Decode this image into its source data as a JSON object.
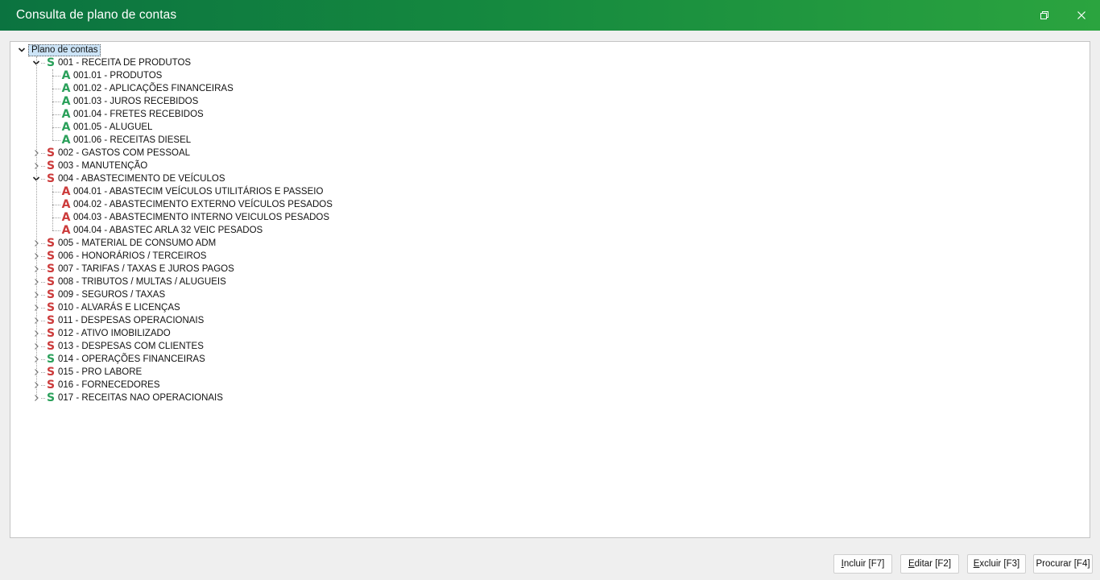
{
  "window": {
    "title": "Consulta de plano de contas"
  },
  "colors": {
    "title_bar_start": "#0b7340",
    "title_bar_end": "#2ba43f",
    "synthetic_green": "#2aa05a",
    "synthetic_red": "#cc3b3b",
    "analytic_green": "#2aa05a",
    "analytic_red": "#cc3b3b",
    "selection": "#cce4f7"
  },
  "tree": {
    "root": {
      "label": "Plano de contas",
      "expanded": true
    },
    "groups": [
      {
        "badge": "S",
        "color": "green",
        "label": "001 - RECEITA DE PRODUTOS",
        "expanded": true,
        "children": [
          {
            "badge": "A",
            "color": "green",
            "label": "001.01 - PRODUTOS"
          },
          {
            "badge": "A",
            "color": "green",
            "label": "001.02 - APLICAÇÕES FINANCEIRAS"
          },
          {
            "badge": "A",
            "color": "green",
            "label": "001.03 - JUROS RECEBIDOS"
          },
          {
            "badge": "A",
            "color": "green",
            "label": "001.04 - FRETES RECEBIDOS"
          },
          {
            "badge": "A",
            "color": "green",
            "label": "001.05 - ALUGUEL"
          },
          {
            "badge": "A",
            "color": "green",
            "label": "001.06 - RECEITAS DIESEL"
          }
        ]
      },
      {
        "badge": "S",
        "color": "red",
        "label": "002 - GASTOS COM PESSOAL",
        "expanded": false,
        "children": []
      },
      {
        "badge": "S",
        "color": "red",
        "label": "003 - MANUTENÇÃO",
        "expanded": false,
        "children": []
      },
      {
        "badge": "S",
        "color": "red",
        "label": "004 - ABASTECIMENTO DE VEÍCULOS",
        "expanded": true,
        "children": [
          {
            "badge": "A",
            "color": "red",
            "label": "004.01 - ABASTECIM VEÍCULOS UTILITÁRIOS E PASSEIO"
          },
          {
            "badge": "A",
            "color": "red",
            "label": "004.02 - ABASTECIMENTO EXTERNO VEÍCULOS PESADOS"
          },
          {
            "badge": "A",
            "color": "red",
            "label": "004.03 - ABASTECIMENTO INTERNO VEICULOS PESADOS"
          },
          {
            "badge": "A",
            "color": "red",
            "label": "004.04 - ABASTEC ARLA 32 VEIC PESADOS"
          }
        ]
      },
      {
        "badge": "S",
        "color": "red",
        "label": "005 - MATERIAL DE CONSUMO ADM",
        "expanded": false,
        "children": []
      },
      {
        "badge": "S",
        "color": "red",
        "label": "006 - HONORÁRIOS / TERCEIROS",
        "expanded": false,
        "children": []
      },
      {
        "badge": "S",
        "color": "red",
        "label": "007 - TARIFAS / TAXAS E JUROS PAGOS",
        "expanded": false,
        "children": []
      },
      {
        "badge": "S",
        "color": "red",
        "label": "008 - TRIBUTOS / MULTAS / ALUGUEIS",
        "expanded": false,
        "children": []
      },
      {
        "badge": "S",
        "color": "red",
        "label": "009 - SEGUROS / TAXAS",
        "expanded": false,
        "children": []
      },
      {
        "badge": "S",
        "color": "red",
        "label": "010 - ALVARÁS E LICENÇAS",
        "expanded": false,
        "children": []
      },
      {
        "badge": "S",
        "color": "red",
        "label": "011 - DESPESAS OPERACIONAIS",
        "expanded": false,
        "children": []
      },
      {
        "badge": "S",
        "color": "red",
        "label": "012 - ATIVO IMOBILIZADO",
        "expanded": false,
        "children": []
      },
      {
        "badge": "S",
        "color": "red",
        "label": "013 - DESPESAS COM CLIENTES",
        "expanded": false,
        "children": []
      },
      {
        "badge": "S",
        "color": "green",
        "label": "014 - OPERAÇÕES FINANCEIRAS",
        "expanded": false,
        "children": []
      },
      {
        "badge": "S",
        "color": "red",
        "label": "015 - PRO LABORE",
        "expanded": false,
        "children": []
      },
      {
        "badge": "S",
        "color": "red",
        "label": "016 - FORNECEDORES",
        "expanded": false,
        "children": []
      },
      {
        "badge": "S",
        "color": "green",
        "label": "017 - RECEITAS NAO OPERACIONAIS",
        "expanded": false,
        "children": []
      }
    ]
  },
  "buttons": {
    "incluir": {
      "mnemonic": "I",
      "rest": "ncluir [F7]"
    },
    "editar": {
      "mnemonic": "E",
      "rest": "ditar [F2]"
    },
    "excluir": {
      "mnemonic": "E",
      "rest": "xcluir [F3]"
    },
    "procurar": {
      "mnemonic": "",
      "rest": "Procurar [F4]"
    }
  }
}
